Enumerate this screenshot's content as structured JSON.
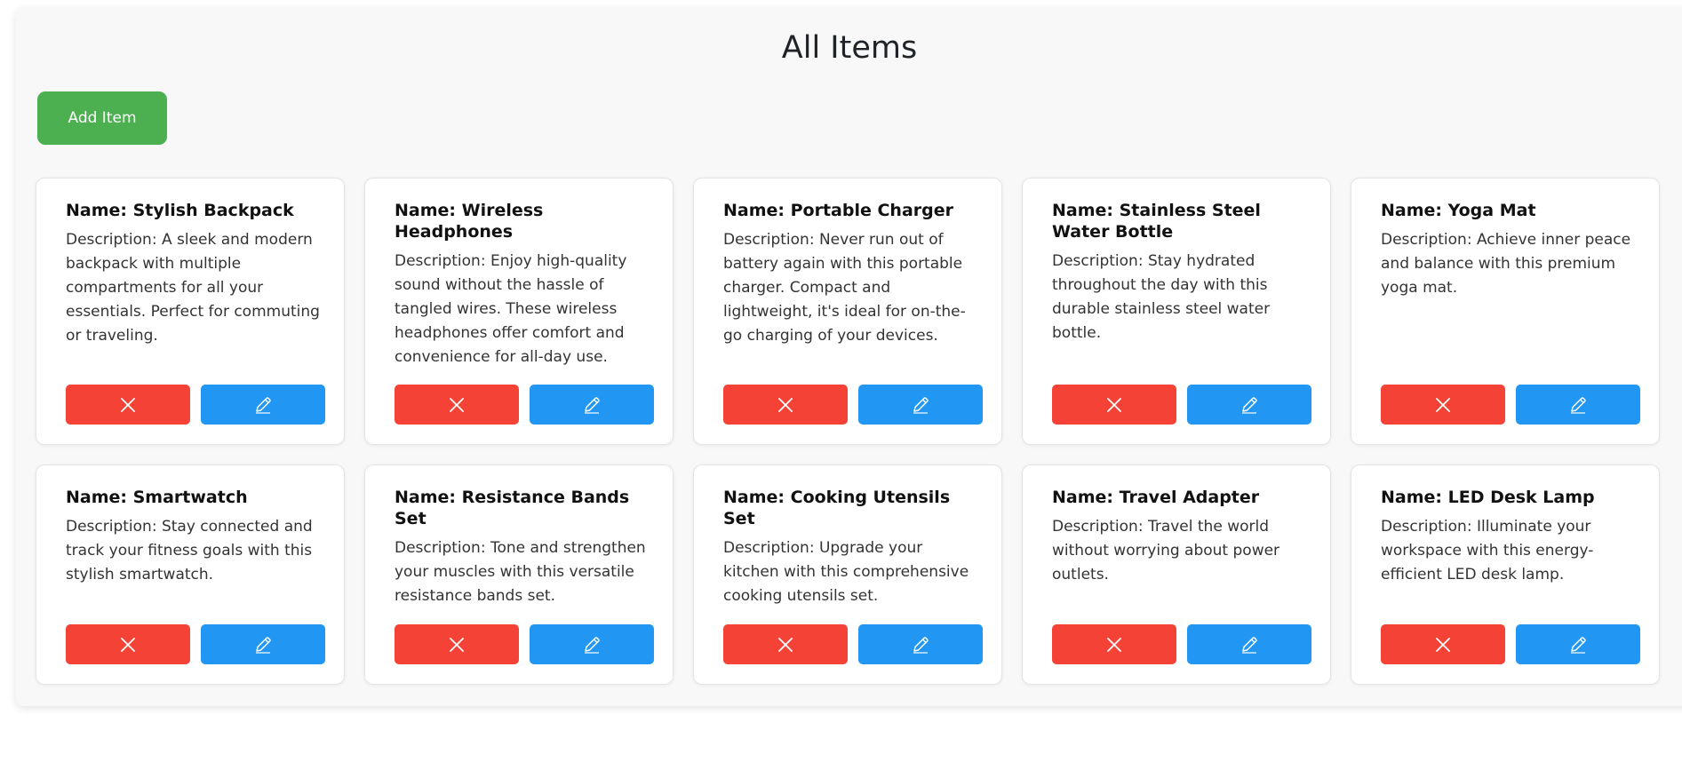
{
  "page": {
    "title": "All Items",
    "add_button_label": "Add Item"
  },
  "colors": {
    "add_button": "#4caf50",
    "delete_button": "#f44336",
    "edit_button": "#2196f3",
    "panel_background": "#f8f8f8"
  },
  "icons": {
    "delete": "close-icon",
    "edit": "pencil-icon"
  },
  "items": [
    {
      "name": "Name: Stylish Backpack",
      "description": "Description: A sleek and modern backpack with multiple compartments for all your essentials. Perfect for commuting or traveling."
    },
    {
      "name": "Name: Wireless Headphones",
      "description": "Description: Enjoy high-quality sound without the hassle of tangled wires. These wireless headphones offer comfort and convenience for all-day use."
    },
    {
      "name": "Name: Portable Charger",
      "description": "Description: Never run out of battery again with this portable charger. Compact and lightweight, it's ideal for on-the-go charging of your devices."
    },
    {
      "name": "Name: Stainless Steel Water Bottle",
      "description": "Description: Stay hydrated throughout the day with this durable stainless steel water bottle."
    },
    {
      "name": "Name: Yoga Mat",
      "description": "Description: Achieve inner peace and balance with this premium yoga mat."
    },
    {
      "name": "Name: Smartwatch",
      "description": "Description: Stay connected and track your fitness goals with this stylish smartwatch."
    },
    {
      "name": "Name: Resistance Bands Set",
      "description": "Description: Tone and strengthen your muscles with this versatile resistance bands set."
    },
    {
      "name": "Name: Cooking Utensils Set",
      "description": "Description: Upgrade your kitchen with this comprehensive cooking utensils set."
    },
    {
      "name": "Name: Travel Adapter",
      "description": "Description: Travel the world without worrying about power outlets."
    },
    {
      "name": "Name: LED Desk Lamp",
      "description": "Description: Illuminate your workspace with this energy-efficient LED desk lamp."
    }
  ]
}
